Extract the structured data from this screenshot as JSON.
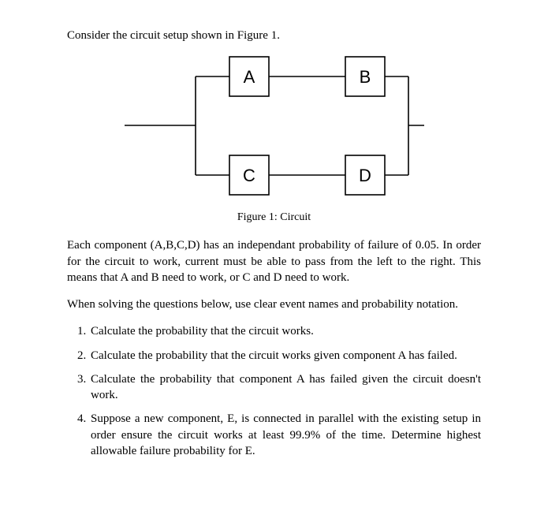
{
  "intro": "Consider the circuit setup shown in Figure 1.",
  "figure": {
    "boxA": "A",
    "boxB": "B",
    "boxC": "C",
    "boxD": "D",
    "caption": "Figure 1: Circuit"
  },
  "para1": "Each component (A,B,C,D) has an independant probability of failure of 0.05. In order for the circuit to work, current must be able to pass from the left to the right. This means that A and B need to work, or C and D need to work.",
  "para2": "When solving the questions below, use clear event names and probability notation.",
  "questions": {
    "q1": "Calculate the probability that the circuit works.",
    "q2": "Calculate the probability that the circuit works given component A has failed.",
    "q3": "Calculate the probability that component A has failed given the circuit doesn't work.",
    "q4": "Suppose a new component, E, is connected in parallel with the existing setup in order ensure the circuit works at least 99.9% of the time. Determine highest allowable failure probability for E."
  }
}
